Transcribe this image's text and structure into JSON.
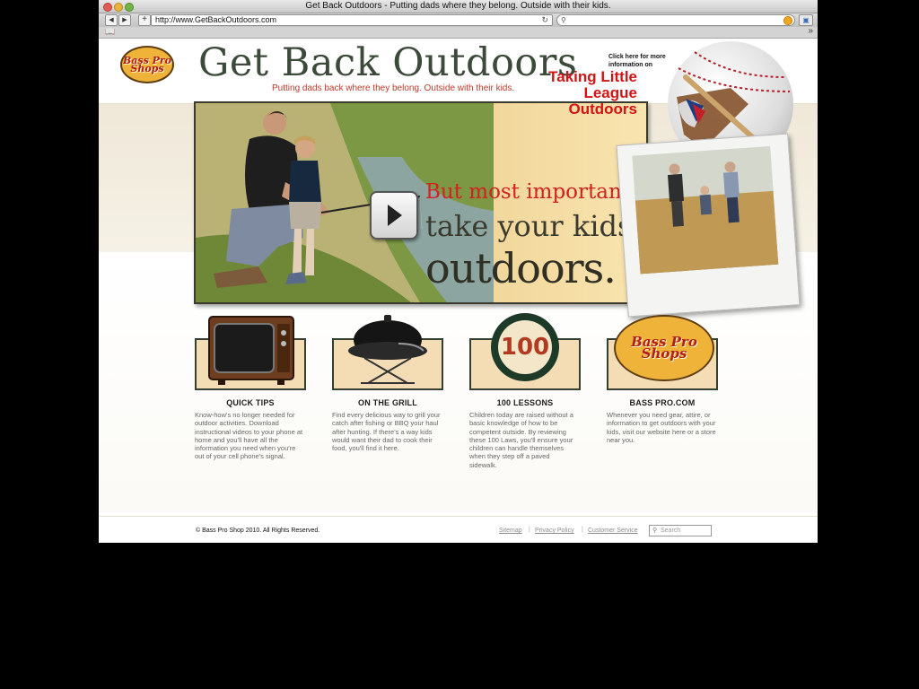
{
  "browser": {
    "window_title": "Get Back Outdoors - Putting dads where they belong. Outside with their kids.",
    "url": "http://www.GetBackOutdoors.com",
    "icons": [
      "back-arrow-icon",
      "forward-arrow-icon",
      "plus-icon",
      "reload-icon",
      "search-icon",
      "snapback-icon",
      "bookmark-icon",
      "bookmarks-book-icon",
      "more-chevron-icon"
    ]
  },
  "header": {
    "logo_text": "Bass Pro Shops",
    "title": "Get Back Outdoors",
    "tagline": "Putting dads back where they belong. Outside with their kids."
  },
  "hero": {
    "line1": "But most importantly,",
    "line2": "take your kids",
    "line3": "outdoors."
  },
  "promo": {
    "note": "Click here for more information on",
    "title": "Taking Little League Outdoors"
  },
  "features": [
    {
      "title": "QUICK TIPS",
      "desc": "Know-how's no longer needed for outdoor activities. Download instructional videos to your phone at home and you'll have all the information you need when you're out of your cell phone's signal.",
      "icon": "tv-icon"
    },
    {
      "title": "ON THE GRILL",
      "desc": "Find every delicious way to grill your catch after fishing or BBQ your haul after hunting. If there's a way kids would want their dad to cook their food, you'll find it here.",
      "icon": "grill-icon"
    },
    {
      "title": "100 LESSONS",
      "desc": "Children today are raised without a basic knowledge of how to be competent outside. By reviewing these 100 Laws, you'll ensure your children can handle themselves when they step off a paved sidewalk.",
      "icon": "badge-100",
      "badge_number": "100"
    },
    {
      "title": "BASS PRO.COM",
      "desc": "Whenever you need gear, attire, or information to get outdoors with your kids, visit our website here or a store near you.",
      "icon": "bass-pro-logo",
      "logo_text": "Bass Pro Shops"
    }
  ],
  "footer": {
    "copyright": "© Bass Pro Shop 2010. All Rights Reserved.",
    "links": [
      "Sitemap",
      "Privacy Policy",
      "Customer Service"
    ],
    "search_placeholder": "Search"
  },
  "colors": {
    "accent_red": "#d41414",
    "title_green": "#3c4a3a",
    "frame_dark": "#34402f",
    "cream": "#f4dcb5"
  }
}
